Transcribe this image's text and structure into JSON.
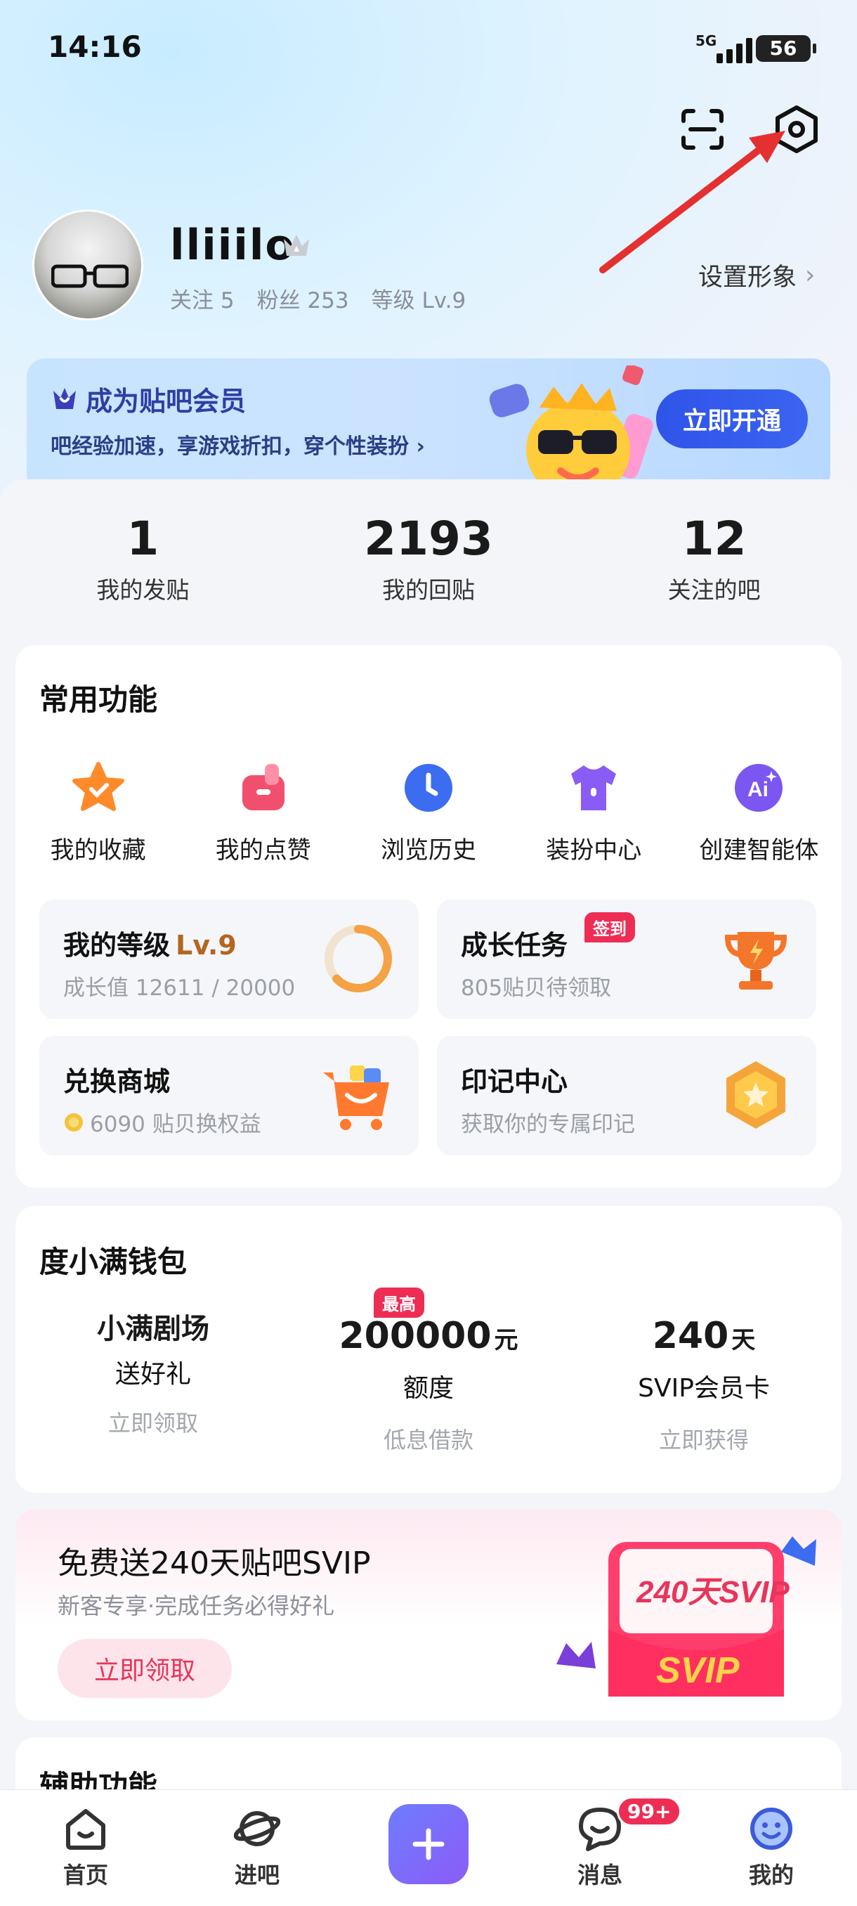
{
  "status_bar": {
    "time": "14:16",
    "network": "5G",
    "battery": "56"
  },
  "header": {
    "scan_icon": "scan-icon",
    "settings_icon": "settings-hexagon-icon"
  },
  "profile": {
    "username": "lliiilo",
    "follow": "关注 5",
    "fans": "粉丝 253",
    "level": "等级 Lv.9",
    "set_image": "设置形象"
  },
  "vip_banner": {
    "title": "成为贴吧会员",
    "subtitle": "吧经验加速，享游戏折扣，穿个性装扮 ›",
    "cta": "立即开通"
  },
  "counts": [
    {
      "value": "1",
      "label": "我的发贴"
    },
    {
      "value": "2193",
      "label": "我的回贴"
    },
    {
      "value": "12",
      "label": "关注的吧"
    }
  ],
  "common_functions": {
    "title": "常用功能",
    "items": [
      {
        "label": "我的收藏",
        "icon": "star-icon"
      },
      {
        "label": "我的点赞",
        "icon": "thumb-up-icon"
      },
      {
        "label": "浏览历史",
        "icon": "clock-icon"
      },
      {
        "label": "装扮中心",
        "icon": "tshirt-icon"
      },
      {
        "label": "创建智能体",
        "icon": "ai-icon"
      }
    ],
    "tiles": {
      "level": {
        "title": "我的等级",
        "level": "Lv.9",
        "sub": "成长值 12611 / 20000",
        "progress": 0.63
      },
      "tasks": {
        "title": "成长任务",
        "tag": "签到",
        "sub": "805贴贝待领取"
      },
      "shop": {
        "title": "兑换商城",
        "sub": "6090 贴贝换权益"
      },
      "marks": {
        "title": "印记中心",
        "sub": "获取你的专属印记"
      }
    }
  },
  "wallet": {
    "title": "度小满钱包",
    "cols": [
      {
        "main": "小满剧场",
        "second": "送好礼",
        "cta": "立即领取"
      },
      {
        "main": "200000",
        "unit": "元",
        "tag": "最高",
        "second": "额度",
        "cta": "低息借款"
      },
      {
        "main": "240",
        "unit": "天",
        "second": "SVIP会员卡",
        "cta": "立即获得"
      }
    ]
  },
  "svip_promo": {
    "title": "免费送240天贴吧SVIP",
    "subtitle": "新客专享·完成任务必得好礼",
    "cta": "立即领取",
    "art_text_top": "240天SVIP",
    "art_text_bottom": "SVIP"
  },
  "aux": {
    "title": "辅助功能"
  },
  "tabbar": {
    "items": [
      {
        "label": "首页",
        "icon": "home-icon"
      },
      {
        "label": "进吧",
        "icon": "planet-icon"
      },
      {
        "label": "",
        "icon": "plus-icon"
      },
      {
        "label": "消息",
        "icon": "message-icon",
        "badge": "99+"
      },
      {
        "label": "我的",
        "icon": "smile-icon"
      }
    ]
  },
  "colors": {
    "accent": "#2f54e9",
    "brand_red": "#ee2d55",
    "level_brown": "#b3661f"
  }
}
